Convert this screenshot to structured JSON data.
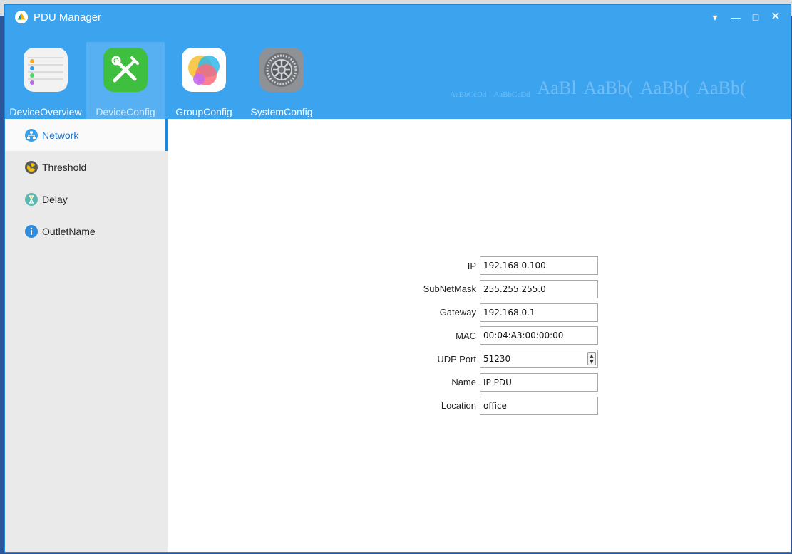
{
  "window": {
    "title": "PDU Manager",
    "controls": {
      "menu": "▾",
      "minimize": "—",
      "maximize": "□",
      "close": "✕"
    }
  },
  "toolbar": {
    "items": [
      {
        "label": "DeviceOverview",
        "icon": "list-icon"
      },
      {
        "label": "DeviceConfig",
        "icon": "tools-icon",
        "active": true
      },
      {
        "label": "GroupConfig",
        "icon": "circles-icon"
      },
      {
        "label": "SystemConfig",
        "icon": "gear-icon"
      }
    ]
  },
  "sidebar": {
    "items": [
      {
        "label": "Network",
        "icon": "network-icon",
        "active": true
      },
      {
        "label": "Threshold",
        "icon": "radiation-icon"
      },
      {
        "label": "Delay",
        "icon": "hourglass-icon"
      },
      {
        "label": "OutletName",
        "icon": "info-icon"
      }
    ]
  },
  "network_form": {
    "ip": {
      "label": "IP",
      "value": "192.168.0.100"
    },
    "subnet": {
      "label": "SubNetMask",
      "value": "255.255.255.0"
    },
    "gateway": {
      "label": "Gateway",
      "value": "192.168.0.1"
    },
    "mac": {
      "label": "MAC",
      "value": "00:04:A3:00:00:00"
    },
    "udp_port": {
      "label": "UDP Port",
      "value": "51230"
    },
    "name": {
      "label": "Name",
      "value": "IP PDU"
    },
    "location": {
      "label": "Location",
      "value": "office"
    }
  },
  "colors": {
    "header_blue": "#2d9cee",
    "sidebar_bg": "#eaeaea",
    "accent": "#1f86d8"
  }
}
